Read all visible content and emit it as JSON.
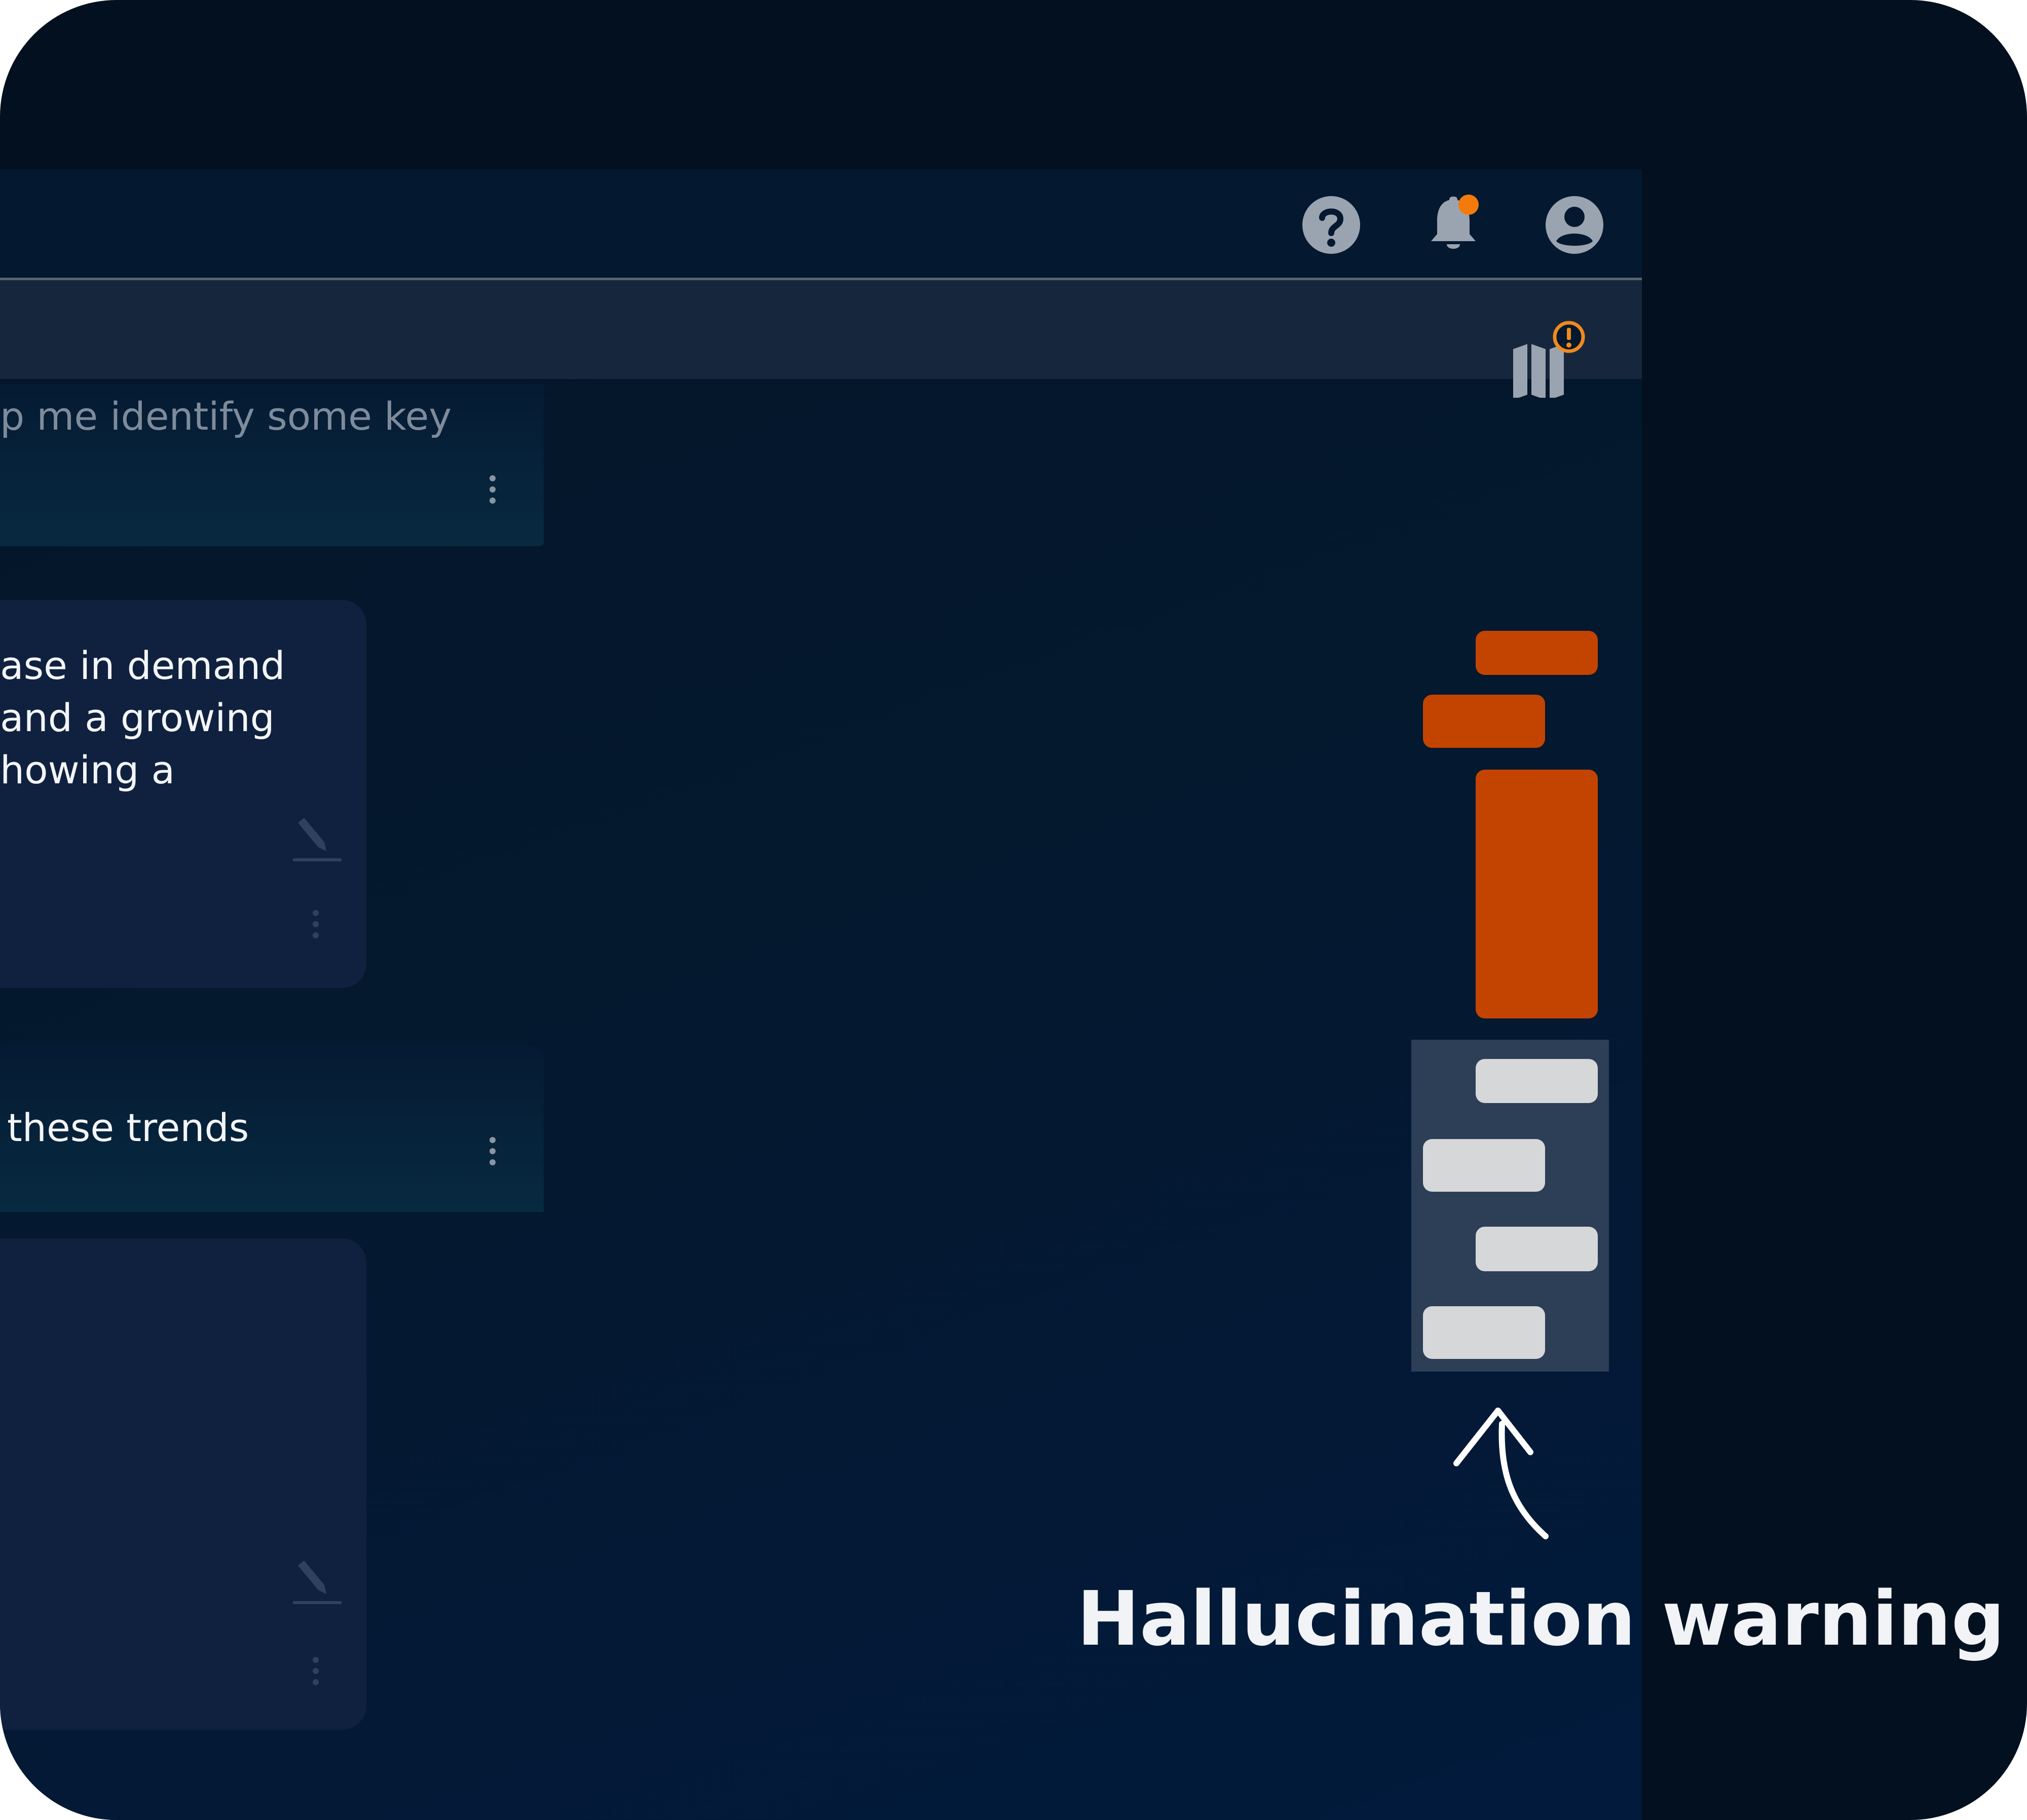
{
  "topbar": {
    "icons": [
      "help-icon",
      "bell-icon",
      "account-icon"
    ],
    "notification_color": "#f47a0c"
  },
  "conversation": {
    "messages": [
      {
        "role": "user",
        "lines": [
          "p me identify some key"
        ]
      },
      {
        "role": "assistant",
        "lines": [
          "ase in demand",
          "and a growing",
          "howing a"
        ]
      },
      {
        "role": "user",
        "lines": [
          "these trends"
        ]
      },
      {
        "role": "assistant",
        "lines": []
      }
    ]
  },
  "minimap": {
    "icon": "map-icon",
    "badge_icon": "alert-circle-icon",
    "warning_color": "#c34400",
    "normal_color": "#d6d7d9",
    "badge_color": "#f08a1c"
  },
  "annotation": {
    "arrow_icon": "curved-arrow-icon",
    "caption": "Hallucination warning"
  }
}
